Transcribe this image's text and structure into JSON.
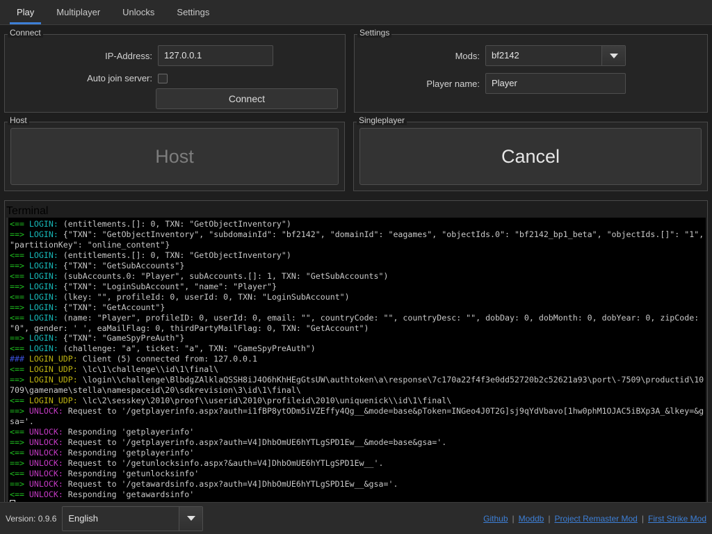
{
  "tabs": [
    {
      "label": "Play",
      "active": true
    },
    {
      "label": "Multiplayer",
      "active": false
    },
    {
      "label": "Unlocks",
      "active": false
    },
    {
      "label": "Settings",
      "active": false
    }
  ],
  "connect": {
    "title": "Connect",
    "ip_label": "IP-Address:",
    "ip_value": "127.0.0.1",
    "ip_placeholder": "127.0.0.1",
    "autojoin_label": "Auto join server:",
    "autojoin_checked": false,
    "connect_button": "Connect"
  },
  "settings": {
    "title": "Settings",
    "mods_label": "Mods:",
    "mods_value": "bf2142",
    "player_label": "Player name:",
    "player_value": "Player",
    "player_placeholder": "Player"
  },
  "host": {
    "title": "Host",
    "button_label": "Host",
    "disabled": true
  },
  "singleplayer": {
    "title": "Singleplayer",
    "button_label": "Cancel",
    "disabled": false
  },
  "terminal": {
    "title": "Terminal",
    "lines": [
      {
        "arrow": "<==",
        "arrow_kind": "in",
        "tag": "LOGIN:",
        "tag_kind": "login",
        "msg": " (entitlements.[]: 0, TXN: \"GetObjectInventory\")"
      },
      {
        "arrow": "==>",
        "arrow_kind": "out",
        "tag": "LOGIN:",
        "tag_kind": "login",
        "msg": " {\"TXN\": \"GetObjectInventory\", \"subdomainId\": \"bf2142\", \"domainId\": \"eagames\", \"objectIds.0\": \"bf2142_bp1_beta\", \"objectIds.[]\": \"1\", \"partitionKey\": \"online_content\"}"
      },
      {
        "arrow": "<==",
        "arrow_kind": "in",
        "tag": "LOGIN:",
        "tag_kind": "login",
        "msg": " (entitlements.[]: 0, TXN: \"GetObjectInventory\")"
      },
      {
        "arrow": "==>",
        "arrow_kind": "out",
        "tag": "LOGIN:",
        "tag_kind": "login",
        "msg": " {\"TXN\": \"GetSubAccounts\"}"
      },
      {
        "arrow": "<==",
        "arrow_kind": "in",
        "tag": "LOGIN:",
        "tag_kind": "login",
        "msg": " (subAccounts.0: \"Player\", subAccounts.[]: 1, TXN: \"GetSubAccounts\")"
      },
      {
        "arrow": "==>",
        "arrow_kind": "out",
        "tag": "LOGIN:",
        "tag_kind": "login",
        "msg": " {\"TXN\": \"LoginSubAccount\", \"name\": \"Player\"}"
      },
      {
        "arrow": "<==",
        "arrow_kind": "in",
        "tag": "LOGIN:",
        "tag_kind": "login",
        "msg": " (lkey: \"\", profileId: 0, userId: 0, TXN: \"LoginSubAccount\")"
      },
      {
        "arrow": "==>",
        "arrow_kind": "out",
        "tag": "LOGIN:",
        "tag_kind": "login",
        "msg": " {\"TXN\": \"GetAccount\"}"
      },
      {
        "arrow": "<==",
        "arrow_kind": "in",
        "tag": "LOGIN:",
        "tag_kind": "login",
        "msg": " (name: \"Player\", profileID: 0, userId: 0, email: \"\", countryCode: \"\", countryDesc: \"\", dobDay: 0, dobMonth: 0, dobYear: 0, zipCode: \"0\", gender: ' ', eaMailFlag: 0, thirdPartyMailFlag: 0, TXN: \"GetAccount\")"
      },
      {
        "arrow": "==>",
        "arrow_kind": "out",
        "tag": "LOGIN:",
        "tag_kind": "login",
        "msg": " {\"TXN\": \"GameSpyPreAuth\"}"
      },
      {
        "arrow": "<==",
        "arrow_kind": "in",
        "tag": "LOGIN:",
        "tag_kind": "login",
        "msg": " (challenge: \"a\", ticket: \"a\", TXN: \"GameSpyPreAuth\")"
      },
      {
        "arrow": "###",
        "arrow_kind": "hash",
        "tag": "LOGIN_UDP:",
        "tag_kind": "udp",
        "msg": " Client (5) connected from: 127.0.0.1"
      },
      {
        "arrow": "<==",
        "arrow_kind": "in",
        "tag": "LOGIN_UDP:",
        "tag_kind": "udp",
        "msg": " \\lc\\1\\challenge\\\\id\\1\\final\\"
      },
      {
        "arrow": "==>",
        "arrow_kind": "out",
        "tag": "LOGIN_UDP:",
        "tag_kind": "udp",
        "msg": " \\login\\\\challenge\\BlbdgZAlklaQSSH8iJ4O6hKhHEgGtsUW\\authtoken\\a\\response\\7c170a22f4f3e0dd52720b2c52621a93\\port\\-7509\\productid\\10709\\gamename\\stella\\namespaceid\\20\\sdkrevision\\3\\id\\1\\final\\"
      },
      {
        "arrow": "<==",
        "arrow_kind": "in",
        "tag": "LOGIN_UDP:",
        "tag_kind": "udp",
        "msg": " \\lc\\2\\sesskey\\2010\\proof\\\\userid\\2010\\profileid\\2010\\uniquenick\\\\id\\1\\final\\"
      },
      {
        "arrow": "==>",
        "arrow_kind": "out",
        "tag": "UNLOCK:",
        "tag_kind": "unlock",
        "msg": " Request to '/getplayerinfo.aspx?auth=i1fBP8ytODm5iVZEffy4Qg__&mode=base&pToken=INGeo4J0T2G]sj9qYdVbavo[1hw0phM1OJAC5iBXp3A_&lkey=&gsa='."
      },
      {
        "arrow": "<==",
        "arrow_kind": "in",
        "tag": "UNLOCK:",
        "tag_kind": "unlock",
        "msg": " Responding 'getplayerinfo'"
      },
      {
        "arrow": "==>",
        "arrow_kind": "out",
        "tag": "UNLOCK:",
        "tag_kind": "unlock",
        "msg": " Request to '/getplayerinfo.aspx?auth=V4]DhbOmUE6hYTLgSPD1Ew__&mode=base&gsa='."
      },
      {
        "arrow": "<==",
        "arrow_kind": "in",
        "tag": "UNLOCK:",
        "tag_kind": "unlock",
        "msg": " Responding 'getplayerinfo'"
      },
      {
        "arrow": "==>",
        "arrow_kind": "out",
        "tag": "UNLOCK:",
        "tag_kind": "unlock",
        "msg": " Request to '/getunlocksinfo.aspx?&auth=V4]DhbOmUE6hYTLgSPD1Ew__'."
      },
      {
        "arrow": "<==",
        "arrow_kind": "in",
        "tag": "UNLOCK:",
        "tag_kind": "unlock",
        "msg": " Responding 'getunlocksinfo'"
      },
      {
        "arrow": "==>",
        "arrow_kind": "out",
        "tag": "UNLOCK:",
        "tag_kind": "unlock",
        "msg": " Request to '/getawardsinfo.aspx?auth=V4]DhbOmUE6hYTLgSPD1Ew__&gsa='."
      },
      {
        "arrow": "<==",
        "arrow_kind": "in",
        "tag": "UNLOCK:",
        "tag_kind": "unlock",
        "msg": " Responding 'getawardsinfo'"
      }
    ]
  },
  "statusbar": {
    "version_label": "Version:  0.9.6",
    "language_value": "English",
    "links": [
      {
        "label": "Github"
      },
      {
        "label": "Moddb"
      },
      {
        "label": "Project Remaster Mod"
      },
      {
        "label": "First Strike Mod"
      }
    ],
    "separator": "|"
  },
  "colors": {
    "accent": "#3d7fd6",
    "terminal_bg": "#000000",
    "arrow_green": "#1fbf1f",
    "arrow_blue": "#3a4fd8",
    "tag_login": "#16b7b7",
    "tag_udp": "#bdb312",
    "tag_unlock": "#c33ac3"
  }
}
